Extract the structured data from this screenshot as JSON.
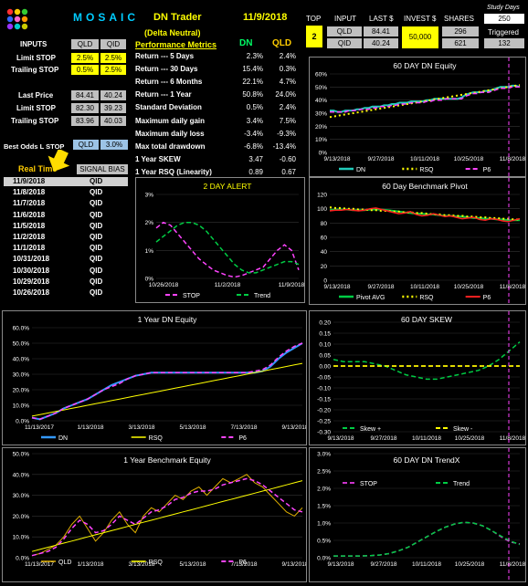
{
  "header": {
    "logo": "MOSAIC",
    "title": "DN Trader",
    "subtitle": "(Delta Neutral)",
    "date": "11/9/2018",
    "study_days_label": "Study Days",
    "study_days": "250",
    "triggered_label": "Triggered",
    "triggered": "132"
  },
  "top_table": {
    "top_label": "TOP",
    "top_value": "2",
    "input_label": "INPUT",
    "last_label": "LAST $",
    "invest_label": "INVEST $",
    "shares_label": "SHARES",
    "invest": "50,000",
    "rows": [
      {
        "sym": "QLD",
        "last": "84.41",
        "shares": "296"
      },
      {
        "sym": "QID",
        "last": "40.24",
        "shares": "621"
      }
    ]
  },
  "inputs": {
    "label": "INPUTS",
    "col1": "QLD",
    "col2": "QID",
    "limit_stop_label": "Limit STOP",
    "limit_stop": [
      "2.5%",
      "2.5%"
    ],
    "trailing_stop_label": "Trailing STOP",
    "trailing_stop": [
      "0.5%",
      "2.5%"
    ],
    "last_price_label": "Last Price",
    "last_price": [
      "84.41",
      "40.24"
    ],
    "limit_stop2_label": "Limit STOP",
    "limit_stop2": [
      "82.30",
      "39.23"
    ],
    "trailing_stop2_label": "Trailing STOP",
    "trailing_stop2": [
      "83.96",
      "40.03"
    ],
    "best_odds_label": "Best Odds L STOP",
    "best_odds_sym": "QLD",
    "best_odds_val": "3.0%"
  },
  "metrics": {
    "header": "Performance Metrics",
    "col_dn": "DN",
    "col_qld": "QLD",
    "rows": [
      {
        "label": "Return --- 5 Days",
        "dn": "2.3%",
        "qld": "2.4%"
      },
      {
        "label": "Return --- 30 Days",
        "dn": "15.4%",
        "qld": "0.3%"
      },
      {
        "label": "Return --- 6 Months",
        "dn": "22.1%",
        "qld": "4.7%"
      },
      {
        "label": "Return --- 1 Year",
        "dn": "50.8%",
        "qld": "24.0%"
      },
      {
        "label": "Standard Deviation",
        "dn": "0.5%",
        "qld": "2.4%"
      },
      {
        "label": "Maximum daily gain",
        "dn": "3.4%",
        "qld": "7.5%"
      },
      {
        "label": "Maximum daily loss",
        "dn": "-3.4%",
        "qld": "-9.3%"
      },
      {
        "label": "Max total drawdown",
        "dn": "-6.8%",
        "qld": "-13.4%"
      },
      {
        "label": "1 Year SKEW",
        "dn": "3.47",
        "qld": "-0.60"
      },
      {
        "label": "1 Year RSQ  (Linearity)",
        "dn": "0.89",
        "qld": "0.67"
      }
    ]
  },
  "signals": {
    "col_time": "Real Time",
    "col_bias": "SIGNAL BIAS",
    "rows": [
      {
        "date": "11/9/2018",
        "bias": "QID"
      },
      {
        "date": "11/8/2018",
        "bias": "QID"
      },
      {
        "date": "11/7/2018",
        "bias": "QID"
      },
      {
        "date": "11/6/2018",
        "bias": "QID"
      },
      {
        "date": "11/5/2018",
        "bias": "QID"
      },
      {
        "date": "11/2/2018",
        "bias": "QID"
      },
      {
        "date": "11/1/2018",
        "bias": "QID"
      },
      {
        "date": "10/31/2018",
        "bias": "QID"
      },
      {
        "date": "10/30/2018",
        "bias": "QID"
      },
      {
        "date": "10/29/2018",
        "bias": "QID"
      },
      {
        "date": "10/26/2018",
        "bias": "QID"
      }
    ]
  },
  "colors": {
    "yellow": "#ffff00",
    "green": "#00cc44",
    "magenta": "#ff44ff",
    "teal": "#22ccbb",
    "red": "#ff2020",
    "blue": "#3399ff",
    "gold": "#e0b000",
    "dash": "#cc33cc"
  },
  "chart_data": [
    {
      "type": "line",
      "title": "60 DAY  DN  Equity",
      "x_ticks": [
        "9/13/2018",
        "9/27/2018",
        "10/11/2018",
        "10/25/2018",
        "11/8/2018"
      ],
      "y_ticks": [
        "0%",
        "10%",
        "20%",
        "30%",
        "40%",
        "50%",
        "60%"
      ],
      "ylim": [
        0,
        60
      ],
      "legend": [
        "DN",
        "RSQ",
        "P6"
      ],
      "series": [
        {
          "name": "DN",
          "values": [
            32,
            32,
            31,
            31,
            32,
            32,
            32,
            33,
            33,
            34,
            34,
            35,
            35,
            35,
            36,
            36,
            37,
            37,
            38,
            38,
            38,
            39,
            39,
            39,
            39,
            40,
            40,
            41,
            41,
            41,
            41,
            41,
            41,
            41,
            42,
            44,
            45,
            46,
            46,
            46,
            47,
            47,
            48,
            49,
            50,
            50,
            50,
            51,
            51,
            50
          ]
        },
        {
          "name": "RSQ",
          "values": [
            27,
            27.5,
            28,
            28.5,
            29,
            29.5,
            30,
            30.5,
            31,
            31.5,
            32,
            32.5,
            33,
            33.5,
            34,
            34.5,
            35,
            35.5,
            36,
            36.5,
            37,
            37.5,
            38,
            38.5,
            39,
            39.5,
            40,
            40.5,
            41,
            41.5,
            42,
            42.5,
            43,
            43.5,
            44,
            44.5,
            45,
            45.5,
            46,
            46.5,
            47,
            47.5,
            48,
            48.5,
            49,
            49.5,
            50,
            50.5,
            51,
            51.5
          ]
        },
        {
          "name": "P6",
          "values": [
            31,
            31,
            31,
            31,
            31,
            32,
            32,
            32,
            33,
            33,
            33,
            34,
            34,
            35,
            35,
            35,
            36,
            36,
            37,
            37,
            37,
            38,
            38,
            38,
            38,
            39,
            39,
            40,
            40,
            40,
            41,
            41,
            41,
            41,
            41,
            43,
            44,
            45,
            45,
            46,
            46,
            46,
            47,
            48,
            49,
            49,
            49,
            50,
            50,
            50
          ]
        }
      ]
    },
    {
      "type": "line",
      "title": "2 DAY ALERT",
      "x_ticks": [
        "10/26/2018",
        "11/2/2018",
        "11/9/2018"
      ],
      "y_ticks": [
        "0%",
        "1%",
        "2%",
        "3%"
      ],
      "ylim": [
        0,
        3
      ],
      "legend": [
        "STOP",
        "Trend"
      ],
      "series": [
        {
          "name": "STOP",
          "values": [
            1.8,
            2.0,
            1.9,
            1.6,
            1.3,
            1.0,
            0.7,
            0.5,
            0.3,
            0.2,
            0.1,
            0.05,
            0.1,
            0.2,
            0.3,
            0.4,
            0.7,
            1.0,
            1.2,
            1.0,
            0.3
          ]
        },
        {
          "name": "Trend",
          "values": [
            1.3,
            1.5,
            1.7,
            1.9,
            2.0,
            2.0,
            1.9,
            1.7,
            1.4,
            1.1,
            0.8,
            0.5,
            0.3,
            0.2,
            0.2,
            0.3,
            0.4,
            0.5,
            0.6,
            0.6,
            0.5
          ]
        }
      ]
    },
    {
      "type": "line",
      "title": "60  Day  Benchmark Pivot",
      "x_ticks": [
        "9/13/2018",
        "9/27/2018",
        "10/11/2018",
        "10/25/2018",
        "11/8/2018"
      ],
      "y_ticks": [
        "0",
        "20",
        "40",
        "60",
        "80",
        "100",
        "120"
      ],
      "ylim": [
        0,
        120
      ],
      "legend": [
        "Pivot AVG",
        "RSQ",
        "P6"
      ],
      "series": [
        {
          "name": "Pivot AVG",
          "values": [
            98,
            99,
            99,
            99,
            98,
            98,
            98,
            99,
            99,
            99,
            98,
            97,
            96,
            95,
            94,
            93,
            93,
            92,
            92,
            91,
            90,
            90,
            89,
            89,
            88,
            87,
            87,
            86,
            86,
            85,
            85,
            84,
            84,
            84
          ]
        },
        {
          "name": "RSQ",
          "values": [
            102,
            101,
            101,
            100,
            100,
            99,
            99,
            98,
            98,
            97,
            97,
            96,
            96,
            95,
            95,
            94,
            94,
            93,
            92,
            92,
            91,
            91,
            90,
            90,
            89,
            89,
            88,
            88,
            87,
            87,
            86,
            86,
            85,
            85
          ]
        },
        {
          "name": "P6",
          "values": [
            97,
            98,
            98,
            99,
            98,
            97,
            98,
            100,
            101,
            99,
            97,
            95,
            93,
            94,
            96,
            92,
            90,
            91,
            93,
            91,
            89,
            90,
            88,
            86,
            87,
            88,
            85,
            84,
            86,
            85,
            83,
            82,
            84,
            86
          ]
        }
      ]
    },
    {
      "type": "line",
      "title": "1 Year  DN   Equity",
      "x_ticks": [
        "11/13/2017",
        "1/13/2018",
        "3/13/2018",
        "5/13/2018",
        "7/13/2018",
        "9/13/2018"
      ],
      "y_ticks": [
        "0.0%",
        "10.0%",
        "20.0%",
        "30.0%",
        "40.0%",
        "50.0%",
        "60.0%"
      ],
      "ylim": [
        0,
        60
      ],
      "legend": [
        "DN",
        "RSQ",
        "P6"
      ],
      "series": [
        {
          "name": "DN",
          "values": [
            2,
            1,
            3,
            5,
            8,
            10,
            12,
            14,
            17,
            20,
            23,
            25,
            27,
            29,
            30,
            31,
            31,
            31,
            31,
            31,
            31,
            31,
            31,
            31,
            31,
            31,
            31,
            31,
            31,
            32,
            35,
            40,
            44,
            47,
            50
          ]
        },
        {
          "name": "RSQ",
          "values": [
            3,
            4,
            5,
            6,
            7,
            8,
            9,
            10,
            11,
            12,
            13,
            14,
            15,
            16,
            17,
            18,
            19,
            20,
            21,
            22,
            23,
            24,
            25,
            26,
            27,
            28,
            29,
            30,
            31,
            32,
            33,
            34,
            35,
            36,
            37
          ]
        },
        {
          "name": "P6",
          "values": [
            2,
            1,
            3,
            5,
            8,
            10,
            12,
            14,
            17,
            20,
            22,
            24,
            27,
            29,
            30,
            31,
            31,
            31,
            31,
            31,
            31,
            31,
            31,
            31,
            31,
            31,
            31,
            31,
            32,
            33,
            36,
            41,
            45,
            48,
            50
          ]
        }
      ]
    },
    {
      "type": "line",
      "title": "60 DAY  SKEW",
      "x_ticks": [
        "9/13/2018",
        "9/27/2018",
        "10/11/2018",
        "10/25/2018",
        "11/8/2018"
      ],
      "y_ticks": [
        "-0.30",
        "-0.25",
        "-0.20",
        "-0.15",
        "-0.10",
        "-0.05",
        "0.00",
        "0.05",
        "0.10",
        "0.15",
        "0.20"
      ],
      "ylim": [
        -0.3,
        0.2
      ],
      "legend": [
        "Skew +",
        "Skew -"
      ],
      "series": [
        {
          "name": "Skew +",
          "values": [
            0.03,
            0.02,
            0.02,
            0.02,
            0.01,
            0.0,
            -0.02,
            -0.04,
            -0.05,
            -0.06,
            -0.06,
            -0.05,
            -0.04,
            -0.03,
            -0.02,
            0.0,
            0.03,
            0.07,
            0.11
          ]
        },
        {
          "name": "Skew -",
          "values": [
            0,
            0,
            0,
            0,
            0,
            0,
            0,
            0,
            0,
            0,
            0,
            0,
            0,
            0,
            0,
            0,
            0,
            0,
            0
          ]
        }
      ]
    },
    {
      "type": "line",
      "title": "1 Year  Benchmark Equity",
      "x_ticks": [
        "11/13/2017",
        "1/13/2018",
        "3/13/2018",
        "5/13/2018",
        "7/13/2018",
        "9/13/2018"
      ],
      "y_ticks": [
        "0.0%",
        "10.0%",
        "20.0%",
        "30.0%",
        "40.0%",
        "50.0%"
      ],
      "ylim": [
        0,
        50
      ],
      "legend": [
        "QLD",
        "RSQ",
        "P6"
      ],
      "series": [
        {
          "name": "QLD",
          "values": [
            1,
            2,
            4,
            6,
            10,
            16,
            20,
            14,
            8,
            12,
            18,
            22,
            16,
            12,
            20,
            24,
            22,
            26,
            30,
            28,
            32,
            34,
            30,
            34,
            38,
            36,
            38,
            40,
            36,
            34,
            30,
            26,
            22,
            20,
            24
          ]
        },
        {
          "name": "RSQ",
          "values": [
            3,
            4,
            5,
            6,
            7,
            8,
            9,
            10,
            11,
            12,
            13,
            14,
            15,
            16,
            17,
            18,
            19,
            20,
            21,
            22,
            23,
            24,
            25,
            26,
            27,
            28,
            29,
            30,
            31,
            32,
            33,
            34,
            35,
            36,
            37
          ]
        },
        {
          "name": "P6",
          "values": [
            1,
            2,
            3,
            5,
            9,
            14,
            18,
            16,
            12,
            13,
            16,
            20,
            18,
            16,
            19,
            22,
            23,
            25,
            28,
            29,
            31,
            32,
            32,
            33,
            35,
            36,
            37,
            38,
            37,
            35,
            32,
            29,
            26,
            23,
            22
          ]
        }
      ]
    },
    {
      "type": "line",
      "title": "60 DAY DN TrendX",
      "x_ticks": [
        "9/13/2018",
        "9/27/2018",
        "10/11/2018",
        "10/25/2018",
        "11/8/2018"
      ],
      "y_ticks": [
        "0.0%",
        "0.5%",
        "1.0%",
        "1.5%",
        "2.0%",
        "2.5%",
        "3.0%"
      ],
      "ylim": [
        0,
        3
      ],
      "legend": [
        "STOP",
        "Trend"
      ],
      "series": [
        {
          "name": "STOP",
          "values": [
            0.05,
            0.05,
            0.05,
            0.05,
            0.06,
            0.08,
            0.12,
            0.2,
            0.3,
            0.45,
            0.6,
            0.75,
            0.88,
            0.97,
            1.02,
            1.0,
            0.92,
            0.78,
            0.6,
            0.45,
            0.4
          ]
        },
        {
          "name": "Trend",
          "values": [
            0.05,
            0.05,
            0.05,
            0.05,
            0.06,
            0.08,
            0.12,
            0.2,
            0.3,
            0.45,
            0.6,
            0.75,
            0.88,
            0.97,
            1.02,
            1.0,
            0.92,
            0.78,
            0.62,
            0.48,
            0.38
          ]
        }
      ]
    }
  ]
}
